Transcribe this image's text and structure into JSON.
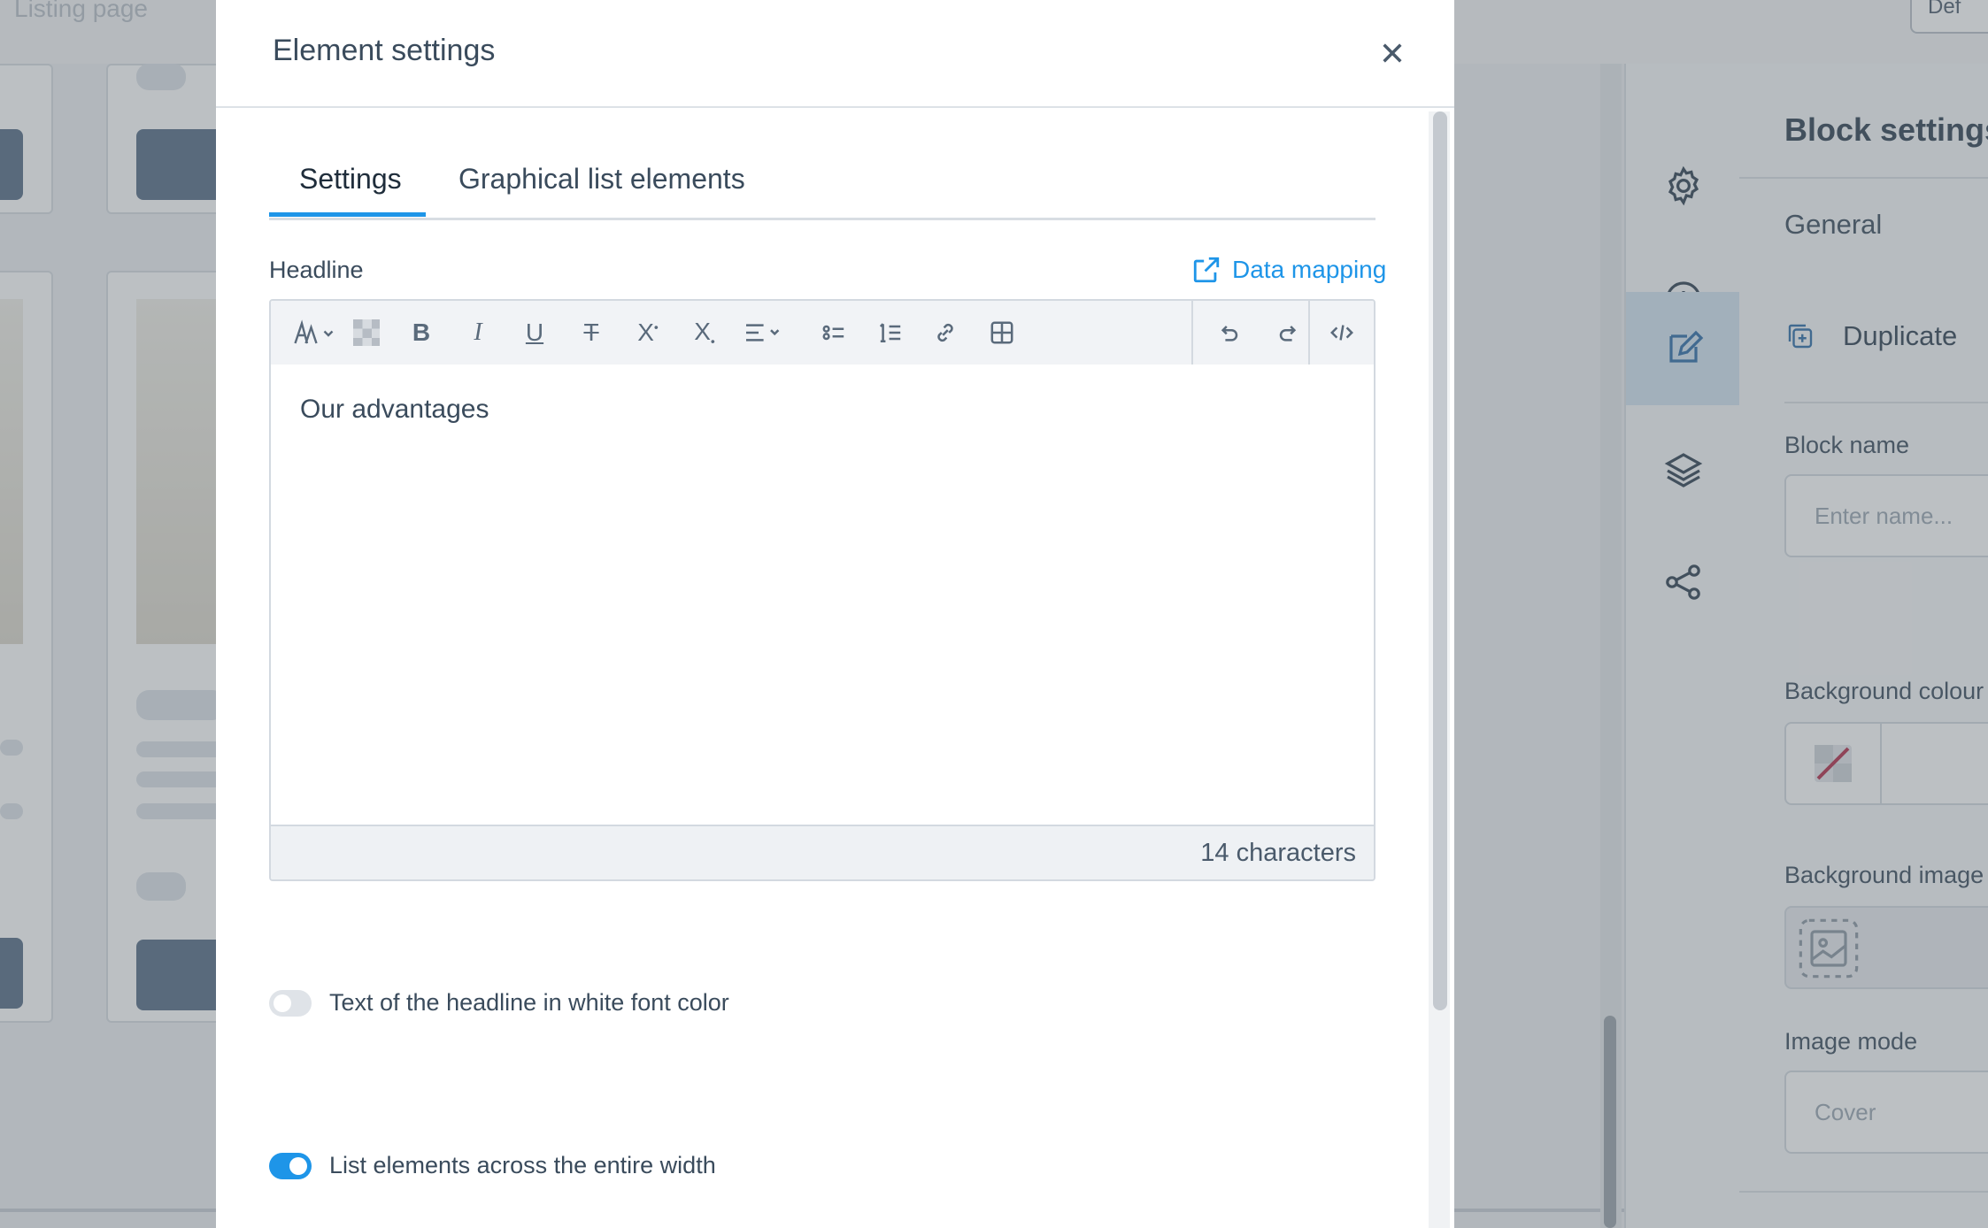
{
  "page": {
    "name": "Listing page",
    "top_button": "Def"
  },
  "rail": {
    "items": [
      {
        "icon": "gear-icon"
      },
      {
        "icon": "plus-circle-icon"
      },
      {
        "icon": "edit-icon",
        "active": true
      },
      {
        "icon": "layers-icon"
      },
      {
        "icon": "share-icon"
      }
    ]
  },
  "block_panel": {
    "title": "Block settings",
    "tab": "General",
    "duplicate_label": "Duplicate",
    "block_name_label": "Block name",
    "block_name_placeholder": "Enter name...",
    "bg_colour_label": "Background colour",
    "bg_image_label": "Background image",
    "image_mode_label": "Image mode",
    "image_mode_value": "Cover"
  },
  "modal": {
    "title": "Element settings",
    "tabs": [
      {
        "label": "Settings",
        "active": true
      },
      {
        "label": "Graphical list elements",
        "active": false
      }
    ],
    "headline_label": "Headline",
    "data_mapping_label": "Data mapping",
    "editor": {
      "content": "Our advantages",
      "char_count": "14 characters",
      "toolbar": [
        "font-size-icon",
        "text-color-icon",
        "bold-icon",
        "italic-icon",
        "underline-icon",
        "strikethrough-icon",
        "superscript-icon",
        "subscript-icon",
        "align-icon",
        "bullet-list-icon",
        "numbered-list-icon",
        "link-icon",
        "table-icon",
        "undo-icon",
        "redo-icon",
        "source-code-icon"
      ]
    },
    "toggles": [
      {
        "label": "Text of the headline in white font color",
        "on": false
      },
      {
        "label": "List elements across the entire width",
        "on": true
      }
    ]
  },
  "colors": {
    "accent": "#1e95e8",
    "text": "#3a4b5c",
    "rail_active": "#d2e3f2"
  }
}
